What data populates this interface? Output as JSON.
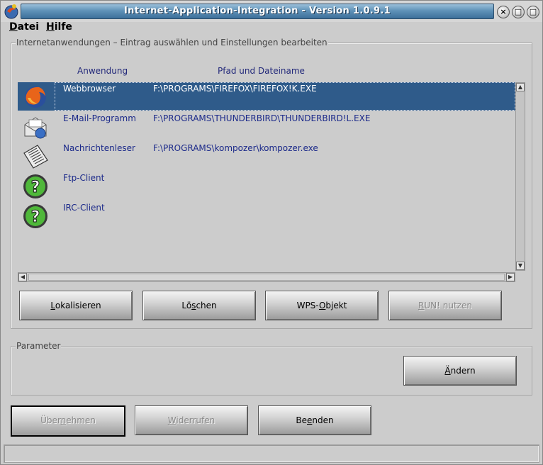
{
  "window": {
    "title": "Internet-Application-Integration - Version 1.0.9.1"
  },
  "titlebar_buttons": {
    "close": "×",
    "restore": "□",
    "maximize": "□"
  },
  "menu": {
    "datei_u": "D",
    "datei_rest": "atei",
    "hilfe_u": "H",
    "hilfe_rest": "ilfe"
  },
  "apps_group": {
    "title": "Internetanwendungen – Eintrag auswählen und Einstellungen bearbeiten"
  },
  "list": {
    "columns": {
      "application": "Anwendung",
      "path": "Pfad und Dateiname"
    },
    "rows": [
      {
        "name": "Webbrowser",
        "path": "F:\\PROGRAMS\\FIREFOX\\FIREFOX!K.EXE",
        "icon": "firefox-icon",
        "selected": true
      },
      {
        "name": "E-Mail-Programm",
        "path": "F:\\PROGRAMS\\THUNDERBIRD\\THUNDERBIRD!L.EXE",
        "icon": "email-icon",
        "selected": false
      },
      {
        "name": "Nachrichtenleser",
        "path": "F:\\PROGRAMS\\kompozer\\kompozer.exe",
        "icon": "newspaper-icon",
        "selected": false
      },
      {
        "name": "Ftp-Client",
        "path": "",
        "icon": "question-icon",
        "selected": false
      },
      {
        "name": "IRC-Client",
        "path": "",
        "icon": "question-icon",
        "selected": false
      }
    ]
  },
  "list_buttons": {
    "locate": {
      "u": "L",
      "rest": "okalisieren"
    },
    "delete_pre": "Lö",
    "delete_u": "s",
    "delete_post": "chen",
    "wps_pre": "WPS-",
    "wps_u": "O",
    "wps_post": "bjekt",
    "run_u": "R",
    "run_rest": "UN! nutzen"
  },
  "param_group": {
    "title": "Parameter"
  },
  "change_button": {
    "u": "Ä",
    "rest": "ndern"
  },
  "bottom_buttons": {
    "apply_pre": "Über",
    "apply_u": "n",
    "apply_post": "ehmen",
    "undo_u": "W",
    "undo_rest": "iderrufen",
    "exit_pre": "Be",
    "exit_u": "e",
    "exit_post": "nden"
  },
  "colors": {
    "selection": "#2f5b8a",
    "list_text": "#1c2a8a",
    "title_gradient_mid": "#5f92b8"
  }
}
